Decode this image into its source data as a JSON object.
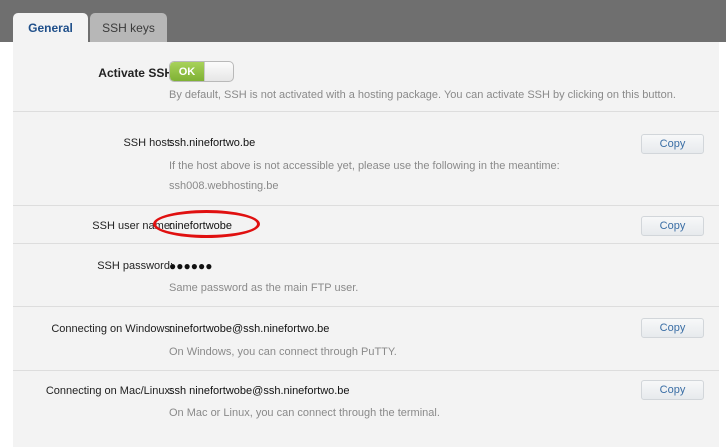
{
  "tabs": [
    {
      "label": "General"
    },
    {
      "label": "SSH keys"
    }
  ],
  "activate": {
    "label": "Activate SSH",
    "toggle_label": "OK",
    "hint": "By default, SSH is not activated with a hosting package. You can activate SSH by clicking on this button."
  },
  "host": {
    "label": "SSH host:",
    "value": "ssh.ninefortwo.be",
    "hint": "If the host above is not accessible yet, please use the following in the meantime:",
    "hint_value": "ssh008.webhosting.be",
    "copy_label": "Copy"
  },
  "username": {
    "label": "SSH user name:",
    "value": "ninefortwobe",
    "copy_label": "Copy"
  },
  "password": {
    "label": "SSH password:",
    "value": "●●●●●●",
    "hint": "Same password as the main FTP user."
  },
  "windows": {
    "label": "Connecting on Windows:",
    "value": "ninefortwobe@ssh.ninefortwo.be",
    "hint": "On Windows, you can connect through PuTTY.",
    "copy_label": "Copy"
  },
  "maclinux": {
    "label": "Connecting on Mac/Linux:",
    "value": "ssh ninefortwobe@ssh.ninefortwo.be",
    "hint": "On Mac or Linux, you can connect through the terminal.",
    "copy_label": "Copy"
  },
  "colors": {
    "accent": "#3a6ea5",
    "toggle_on": "#8cc63f",
    "annotation": "#e01010"
  }
}
